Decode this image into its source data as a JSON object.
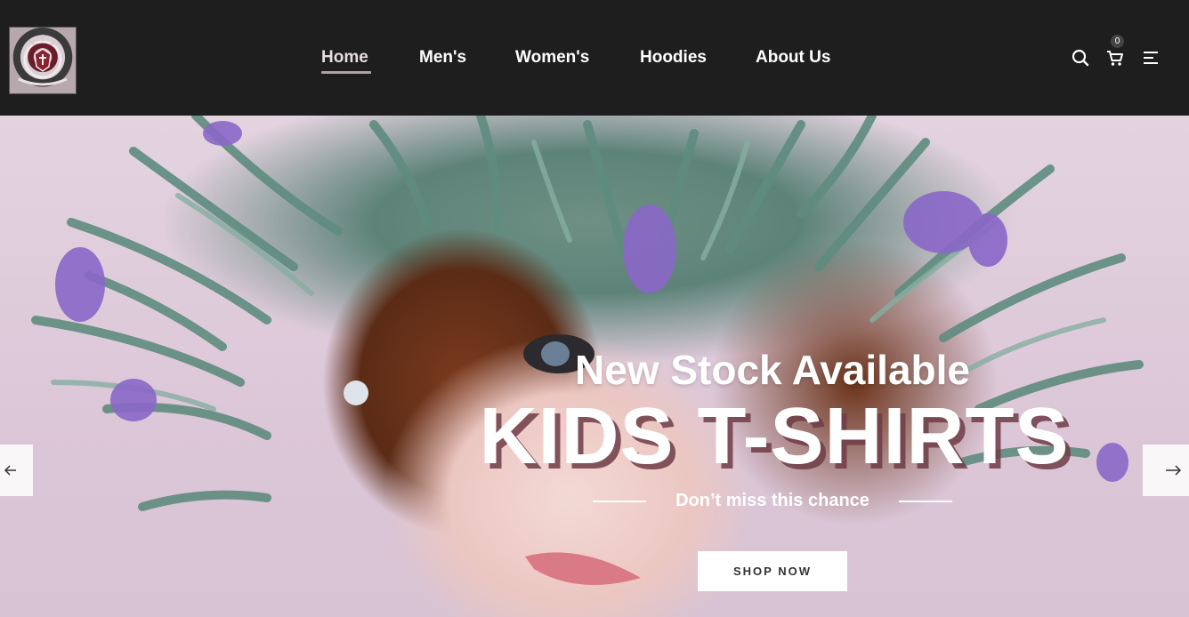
{
  "header": {
    "nav": [
      {
        "label": "Home",
        "active": true
      },
      {
        "label": "Men's",
        "active": false
      },
      {
        "label": "Women's",
        "active": false
      },
      {
        "label": "Hoodies",
        "active": false
      },
      {
        "label": "About Us",
        "active": false
      }
    ],
    "cart_count": "0",
    "icons": [
      "search-icon",
      "cart-icon",
      "menu-icon"
    ]
  },
  "hero": {
    "subtitle": "New Stock Available",
    "title": "KIDS T-SHIRTS",
    "tagline": "Don’t miss this chance",
    "cta_label": "SHOP NOW",
    "prev_icon": "arrow-left-icon",
    "next_icon": "arrow-right-icon"
  },
  "colors": {
    "header_bg": "#1e1e1e",
    "active_underline": "#b49ea6",
    "title_shadow": "#6e3c46"
  }
}
